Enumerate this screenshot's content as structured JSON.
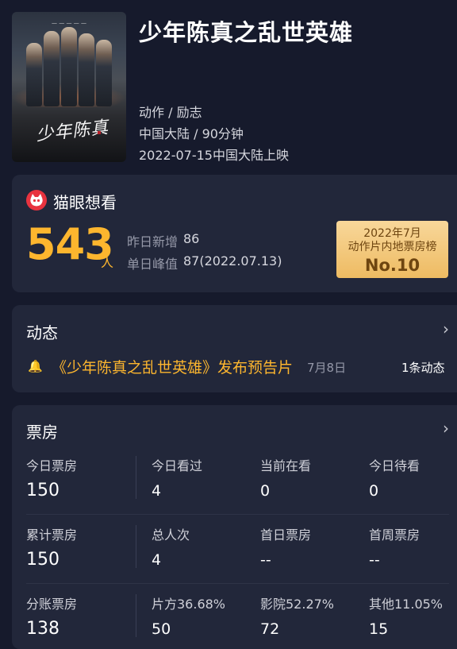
{
  "movie": {
    "title": "少年陈真之乱世英雄",
    "genre": "动作 / 励志",
    "region_duration": "中国大陆 / 90分钟",
    "release": "2022-07-15中国大陆上映"
  },
  "wish": {
    "title": "猫眼想看",
    "count": "543",
    "unit": "人",
    "yesterday_label": "昨日新增",
    "yesterday_value": "86",
    "peak_label": "单日峰值",
    "peak_value": "87(2022.07.13)",
    "rank_line1": "2022年7月",
    "rank_line2": "动作片内地票房榜",
    "rank_no": "No.10"
  },
  "dynamics": {
    "title": "动态",
    "text": "《少年陈真之乱世英雄》发布预告片",
    "date": "7月8日",
    "count": "1条动态"
  },
  "boxoffice": {
    "title": "票房",
    "rows": [
      [
        {
          "label": "今日票房",
          "value": "150"
        },
        {
          "label": "今日看过",
          "value": "4"
        },
        {
          "label": "当前在看",
          "value": "0"
        },
        {
          "label": "今日待看",
          "value": "0"
        }
      ],
      [
        {
          "label": "累计票房",
          "value": "150"
        },
        {
          "label": "总人次",
          "value": "4"
        },
        {
          "label": "首日票房",
          "value": "--"
        },
        {
          "label": "首周票房",
          "value": "--"
        }
      ],
      [
        {
          "label": "分账票房",
          "value": "138"
        },
        {
          "label": "片方36.68%",
          "value": "50"
        },
        {
          "label": "影院52.27%",
          "value": "72"
        },
        {
          "label": "其他11.05%",
          "value": "15"
        }
      ]
    ]
  },
  "colors": {
    "background": "#161a2c",
    "card": "#22273a",
    "accent": "#fdb62e",
    "maoyan_red": "#e8333f"
  }
}
